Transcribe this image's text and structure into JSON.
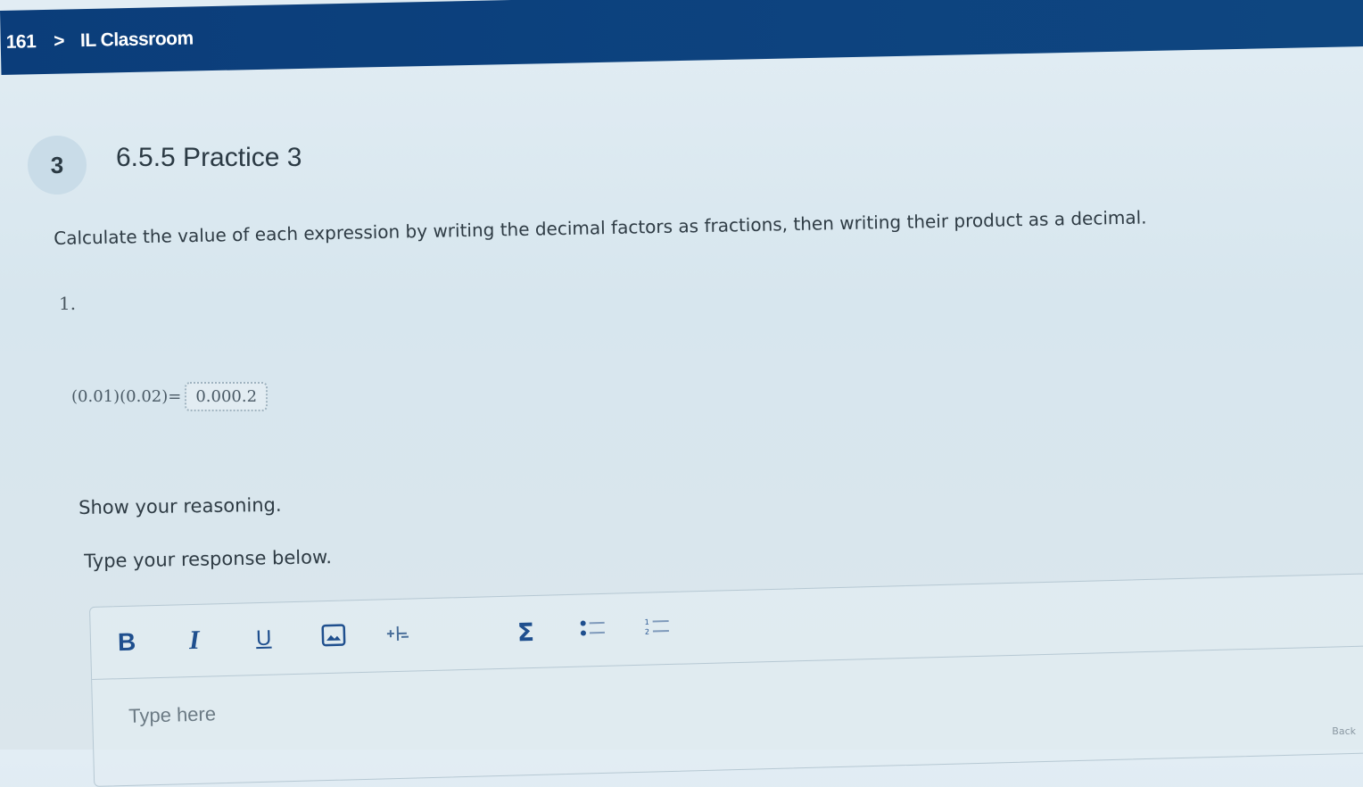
{
  "header": {
    "crumb_number": "161",
    "crumb_separator": ">",
    "crumb_title": "IL Classroom"
  },
  "lesson": {
    "number": "3",
    "title": "6.5.5 Practice 3"
  },
  "instructions": "Calculate the value of each expression by writing the decimal factors as fractions, then writing their product as a decimal.",
  "question": {
    "number": "1.",
    "expression": "(0.01)(0.02)=",
    "answer_value": "0.000.2"
  },
  "prompts": {
    "show_reasoning": "Show your reasoning.",
    "type_response": "Type your response below."
  },
  "editor": {
    "toolbar": {
      "bold_label": "B",
      "italic_label": "I",
      "underline_label": "U",
      "image_icon": "image-icon",
      "subscript_icon": "subscript-icon",
      "sigma_label": "Σ",
      "bullets_icon": "bulleted-list-icon",
      "numbers_icon": "numbered-list-icon"
    },
    "placeholder": "Type here"
  },
  "footer": {
    "back_label": "Back"
  },
  "colors": {
    "header_bg": "#0b3d7a",
    "toolbar_icon": "#1f4f8e",
    "page_bg": "#dbe6ec"
  }
}
